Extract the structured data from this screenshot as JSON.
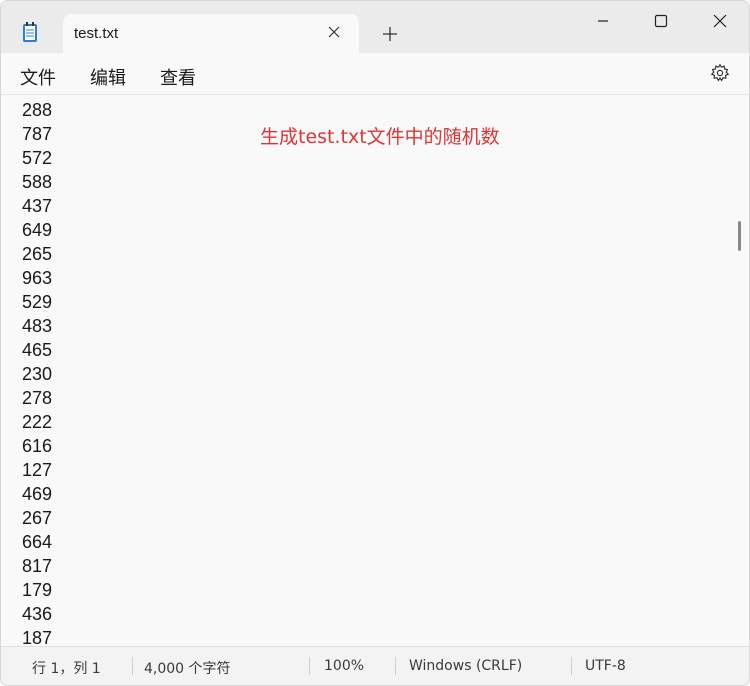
{
  "window": {
    "tab_title": "test.txt"
  },
  "menu": {
    "file": "文件",
    "edit": "编辑",
    "view": "查看"
  },
  "editor": {
    "lines": [
      "288",
      "787",
      "572",
      "588",
      "437",
      "649",
      "265",
      "963",
      "529",
      "483",
      "465",
      "230",
      "278",
      "222",
      "616",
      "127",
      "469",
      "267",
      "664",
      "817",
      "179",
      "436",
      "187"
    ],
    "annotation": "生成test.txt文件中的随机数"
  },
  "status": {
    "position": "行 1，列 1",
    "char_count": "4,000 个字符",
    "zoom": "100%",
    "line_ending": "Windows (CRLF)",
    "encoding": "UTF-8"
  },
  "colors": {
    "annotation": "#e03535",
    "app_icon": "#2a7fd4"
  },
  "icons": {
    "app": "notepad-icon",
    "close_tab": "close-icon",
    "new_tab": "plus-icon",
    "minimize": "minimize-icon",
    "maximize": "maximize-icon",
    "close_window": "close-icon",
    "settings": "gear-icon"
  }
}
